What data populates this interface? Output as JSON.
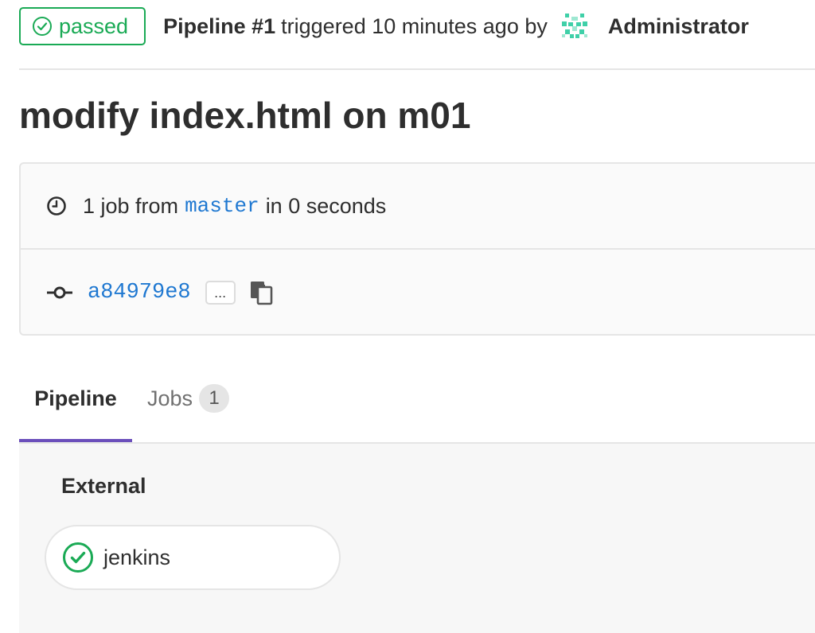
{
  "header": {
    "status_label": "passed",
    "pipeline_label": "Pipeline #1",
    "triggered_text": "triggered 10 minutes ago by",
    "user_name": "Administrator"
  },
  "title": "modify index.html on m01",
  "info": {
    "job_count_text": "1 job from",
    "branch": "master",
    "duration_text": "in 0 seconds",
    "commit_sha": "a84979e8",
    "ellipsis_label": "..."
  },
  "tabs": [
    {
      "label": "Pipeline",
      "active": true
    },
    {
      "label": "Jobs",
      "count": "1",
      "active": false
    }
  ],
  "graph": {
    "stage_title": "External",
    "jobs": [
      {
        "name": "jenkins",
        "status": "success"
      }
    ]
  },
  "colors": {
    "success": "#1aaa55",
    "link": "#1f78d1",
    "active_tab": "#6b4fbb"
  },
  "icons": [
    "status-success-icon",
    "avatar-identicon",
    "clock-icon",
    "commit-icon",
    "copy-icon",
    "check-circle-icon"
  ]
}
